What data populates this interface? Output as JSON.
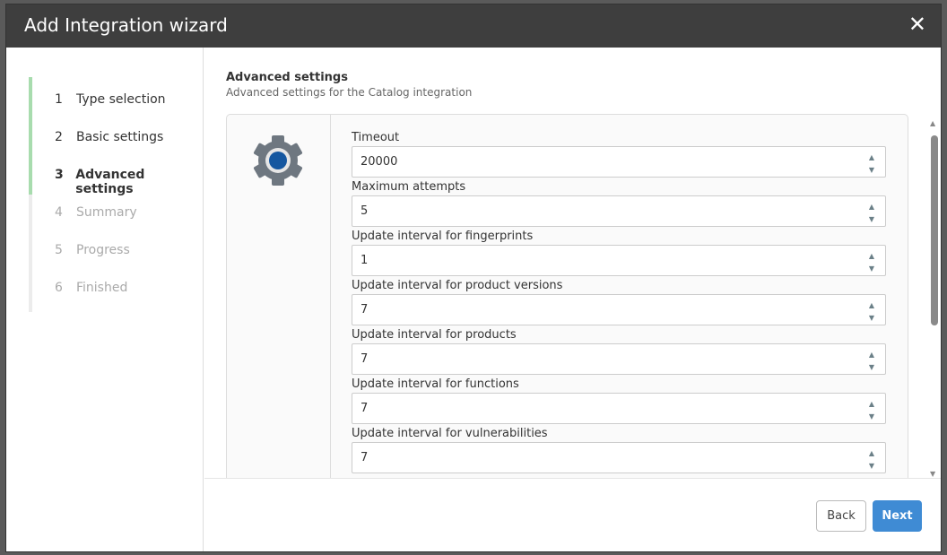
{
  "dialog": {
    "title": "Add Integration wizard",
    "close_icon": "close-icon"
  },
  "steps": [
    {
      "num": "1",
      "label": "Type selection",
      "state": "done"
    },
    {
      "num": "2",
      "label": "Basic settings",
      "state": "done"
    },
    {
      "num": "3",
      "label": "Advanced settings",
      "state": "current"
    },
    {
      "num": "4",
      "label": "Summary",
      "state": "pending"
    },
    {
      "num": "5",
      "label": "Progress",
      "state": "pending"
    },
    {
      "num": "6",
      "label": "Finished",
      "state": "pending"
    }
  ],
  "section": {
    "title": "Advanced settings",
    "subtitle": "Advanced settings for the Catalog integration",
    "icon": "gear-icon"
  },
  "fields": [
    {
      "label": "Timeout",
      "value": "20000"
    },
    {
      "label": "Maximum attempts",
      "value": "5"
    },
    {
      "label": "Update interval for fingerprints",
      "value": "1"
    },
    {
      "label": "Update interval for product versions",
      "value": "7"
    },
    {
      "label": "Update interval for products",
      "value": "7"
    },
    {
      "label": "Update interval for functions",
      "value": "7"
    },
    {
      "label": "Update interval for vulnerabilities",
      "value": "7"
    }
  ],
  "footer": {
    "back": "Back",
    "next": "Next"
  },
  "colors": {
    "header": "#3e3e3e",
    "accent": "#3f8bd4",
    "progress": "#a8dcae"
  }
}
